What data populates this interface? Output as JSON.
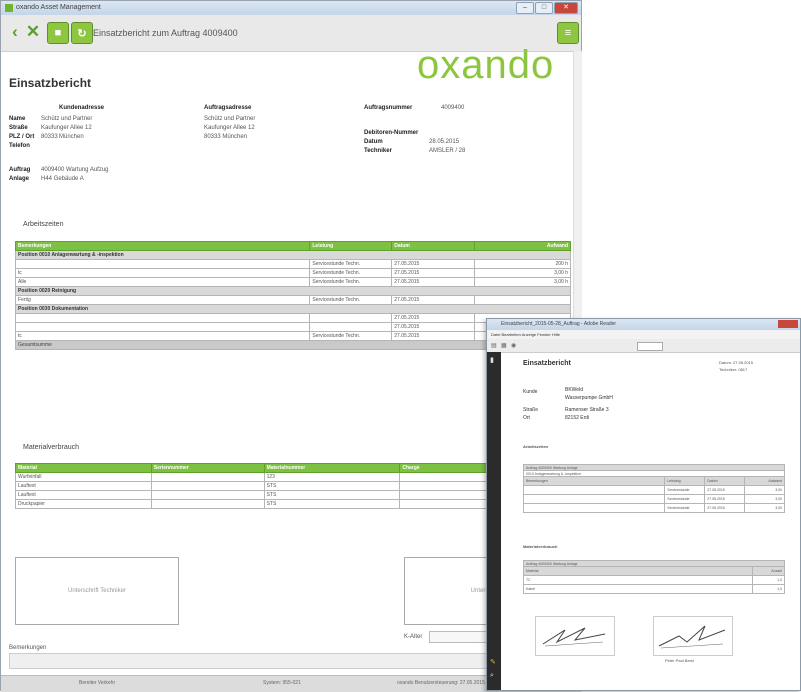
{
  "window": {
    "title": "oxando Asset Management",
    "controls": {
      "minimize": "–",
      "maximize": "□",
      "close": "✕"
    }
  },
  "toolbar": {
    "title": "Einsatzbericht zum Auftrag 4009400",
    "back_icon": "chevron-left-icon",
    "close_icon": "close-icon"
  },
  "logo": "oxando",
  "report": {
    "title": "Einsatzbericht",
    "customer": {
      "heading": "Kundenadresse",
      "name_label": "Name",
      "name": "Schütz und Partner",
      "street_label": "Straße",
      "street": "Kaufunger Allee 12",
      "city_label": "PLZ / Ort",
      "zip": "80333",
      "city": "München",
      "phone_label": "Telefon"
    },
    "order_address": {
      "heading": "Auftragsadresse",
      "line1": "Schütz und Partner",
      "line2": "Kaufunger Allee 12",
      "line3": "80333 München"
    },
    "order_info": {
      "number_label": "Auftragsnummer",
      "number": "4009400",
      "debtor_label": "Debitoren-Nummer",
      "date_label": "Datum",
      "date": "28.05.2015",
      "tech_label": "Techniker",
      "tech": "AMSLER / 28"
    },
    "order_label": "Auftrag",
    "order_value": "4009400 Wartung Aufzug",
    "plant_label": "Anlage",
    "plant_value": "H44 Gebäude A"
  },
  "work": {
    "heading": "Arbeitszeiten",
    "columns": [
      "Bemerkungen",
      "Leistung",
      "Datum",
      "Aufwand"
    ],
    "groups": [
      {
        "title": "Position 0010 Anlagenwartung & -inspektion",
        "rows": [
          [
            "",
            "Servicestunde Techn.",
            "27.05.2015",
            "200 h"
          ],
          [
            "tc",
            "Servicestunde Techn.",
            "27.05.2015",
            "3,00 h"
          ],
          [
            "Alle",
            "Servicestunde Techn.",
            "27.05.2015",
            "3,00 h"
          ]
        ]
      },
      {
        "title": "Position 0020 Reinigung",
        "rows": [
          [
            "Fertig",
            "Servicestunde Techn.",
            "27.05.2015",
            ""
          ]
        ]
      },
      {
        "title": "Position 0030 Dokumentation",
        "rows": [
          [
            "",
            "",
            "27.05.2015",
            ""
          ],
          [
            "",
            "",
            "27.05.2015",
            ""
          ],
          [
            "tc",
            "Servicestunde Techn.",
            "27.05.2015",
            ""
          ]
        ]
      }
    ],
    "sum_label": "Gesamtsumme"
  },
  "material": {
    "heading": "Materialverbrauch",
    "columns": [
      "Material",
      "Seriennummer",
      "Materialnummer",
      "Charge"
    ],
    "rows": [
      [
        "Wurfeinfall",
        "",
        "123",
        ""
      ],
      [
        "Lauftext",
        "",
        "STS",
        ""
      ],
      [
        "Lauftext",
        "",
        "STS",
        ""
      ],
      [
        "Druckpapier",
        "",
        "STS",
        ""
      ]
    ]
  },
  "signature": {
    "technician": "Unterschrift Techniker",
    "customer": "Unterschrift"
  },
  "remarks_label": "Bemerkungen",
  "name_label": "K-Alter",
  "status": {
    "left": "Bereiter Verkehr",
    "mid": "System: 955-021",
    "right": "oxando Benutzersteuerung: 27.05.2015 10:45"
  },
  "pdf": {
    "title": "Einsatzbericht_2015-05-28_Auftrag - Adobe Reader",
    "menu": "Datei  Bearbeiten  Anzeige  Fenster  Hilfe",
    "page_title": "Einsatzbericht",
    "page_meta": [
      "Datum: 27.05.2015",
      "Techniker: 0817"
    ],
    "kunde_label": "Kunde",
    "kunde_lines": [
      "BKWeld",
      "Wasserpumpe GmbH"
    ],
    "strasse_label": "Straße",
    "strasse": "Ramenser Straße 3",
    "ort_label": "Ort",
    "ort": "82152 Erdi",
    "arbeitszeit": "Arbeitszeiten",
    "table1_head": "Auftrag 4009400 Wartung Anlage",
    "table1_sub": "0010 Anlagenwartung & -inspektion",
    "table1_cols": [
      "Bemerkungen",
      "Leistung",
      "Datum",
      "Aufwand"
    ],
    "table1_rows": [
      [
        "",
        "Servicestunde",
        "27.05.2015",
        "3,00"
      ],
      [
        "",
        "Servicestunde",
        "27.05.2015",
        "3,00"
      ],
      [
        "",
        "Servicestunde",
        "27.05.2015",
        "3,00"
      ]
    ],
    "material": "Materialverbrauch",
    "table2_head": "Auftrag 4009400 Wartung Anlage",
    "table2_cols": [
      "Material",
      "Anzahl"
    ],
    "table2_rows": [
      [
        "TC",
        "1,0"
      ],
      [
        "Kabel",
        "1,0"
      ]
    ],
    "sig_name": "Peter Paul Bertz"
  }
}
